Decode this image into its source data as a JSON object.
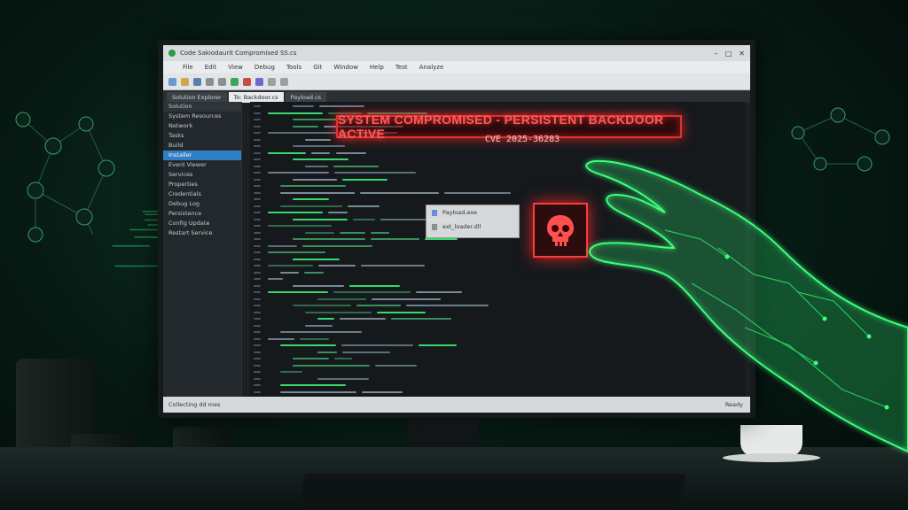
{
  "window": {
    "title": "Code Sakiodaurit Compromised SS.cs",
    "menu": [
      "File",
      "Edit",
      "View",
      "Debug",
      "Tools",
      "Git",
      "Window",
      "Help",
      "Test",
      "Analyze"
    ],
    "tabs": [
      "Solution Explorer",
      "To: Backdoor.cs",
      "Payload.cs"
    ],
    "statusbar": [
      "Collecting dd mes",
      "Ready"
    ]
  },
  "sidebar": {
    "header": "Solution",
    "items": [
      "System Resources",
      "Network",
      "Tasks",
      "Build",
      "Installer",
      "Event Viewer",
      "Services",
      "Properties",
      "Credentials",
      "Debug Log",
      "Persistence",
      "Config Update",
      "Restart Service"
    ]
  },
  "alert": {
    "headline": "SYSTEM COMPROMISED - PERSISTENT BACKDOOR ACTIVE",
    "cve": "CVE 2025-36283"
  },
  "popup": {
    "items": [
      "Payload.exe",
      "ext_loader.dll"
    ]
  },
  "colors": {
    "alert": "#e03030",
    "code_green": "#38d86a",
    "background": "#071a14",
    "hand_glow": "#3cff7a"
  },
  "icons": [
    "skull-icon",
    "network-node-icon",
    "hand-illustration"
  ]
}
